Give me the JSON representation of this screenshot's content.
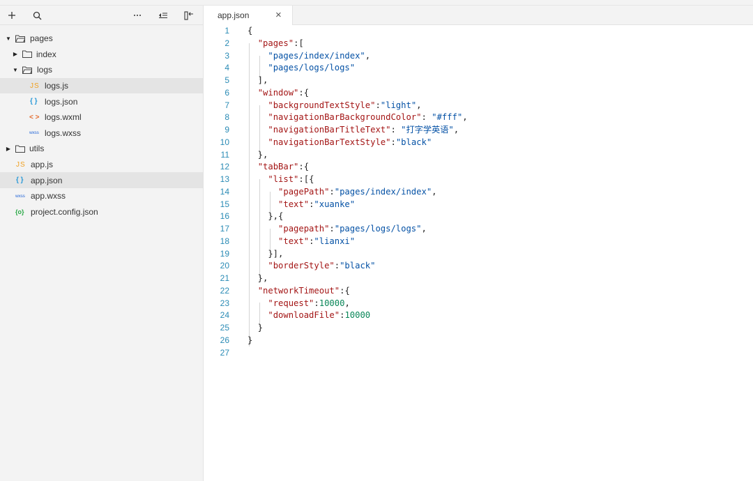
{
  "sidebar": {
    "toolbar": {
      "add_icon": "+",
      "search_icon": "search",
      "more_icon": "···",
      "sort_icon": "collapse-list",
      "split_icon": "panel-back"
    },
    "tree": [
      {
        "label": "pages",
        "type": "folder",
        "expanded": true
      },
      {
        "label": "index",
        "type": "folder",
        "expanded": false
      },
      {
        "label": "logs",
        "type": "folder",
        "expanded": true
      },
      {
        "label": "logs.js",
        "type": "js",
        "icon_text": "JS"
      },
      {
        "label": "logs.json",
        "type": "json",
        "icon_text": "{ }"
      },
      {
        "label": "logs.wxml",
        "type": "wxml",
        "icon_text": "< >"
      },
      {
        "label": "logs.wxss",
        "type": "wxss",
        "icon_text": "wxss"
      },
      {
        "label": "utils",
        "type": "folder",
        "expanded": false
      },
      {
        "label": "app.js",
        "type": "js",
        "icon_text": "JS"
      },
      {
        "label": "app.json",
        "type": "json",
        "icon_text": "{ }"
      },
      {
        "label": "app.wxss",
        "type": "wxss",
        "icon_text": "wxss"
      },
      {
        "label": "project.config.json",
        "type": "cfg",
        "icon_text": "{o}"
      }
    ]
  },
  "editor": {
    "tab": {
      "label": "app.json",
      "close_icon": "×"
    },
    "lines": [
      "{",
      "  \"pages\":[",
      "    \"pages/index/index\",",
      "    \"pages/logs/logs\"",
      "  ],",
      "  \"window\":{",
      "    \"backgroundTextStyle\":\"light\",",
      "    \"navigationBarBackgroundColor\": \"#fff\",",
      "    \"navigationBarTitleText\": \"打字学英语\",",
      "    \"navigationBarTextStyle\":\"black\"",
      "  },",
      "  \"tabBar\":{",
      "    \"list\":[{",
      "      \"pagePath\":\"pages/index/index\",",
      "      \"text\":\"xuanke\"",
      "    },{",
      "      \"pagepath\":\"pages/logs/logs\",",
      "      \"text\":\"lianxi\"",
      "    }],",
      "    \"borderStyle\":\"black\"",
      "  },",
      "  \"networkTimeout\":{",
      "    \"request\":10000,",
      "    \"downloadFile\":10000",
      "  }",
      "}",
      ""
    ]
  },
  "colors": {
    "key": "#a31515",
    "string": "#0451a5",
    "number": "#098658",
    "line_number": "#2a8bb5",
    "selected_row": "#e4e4e4"
  }
}
